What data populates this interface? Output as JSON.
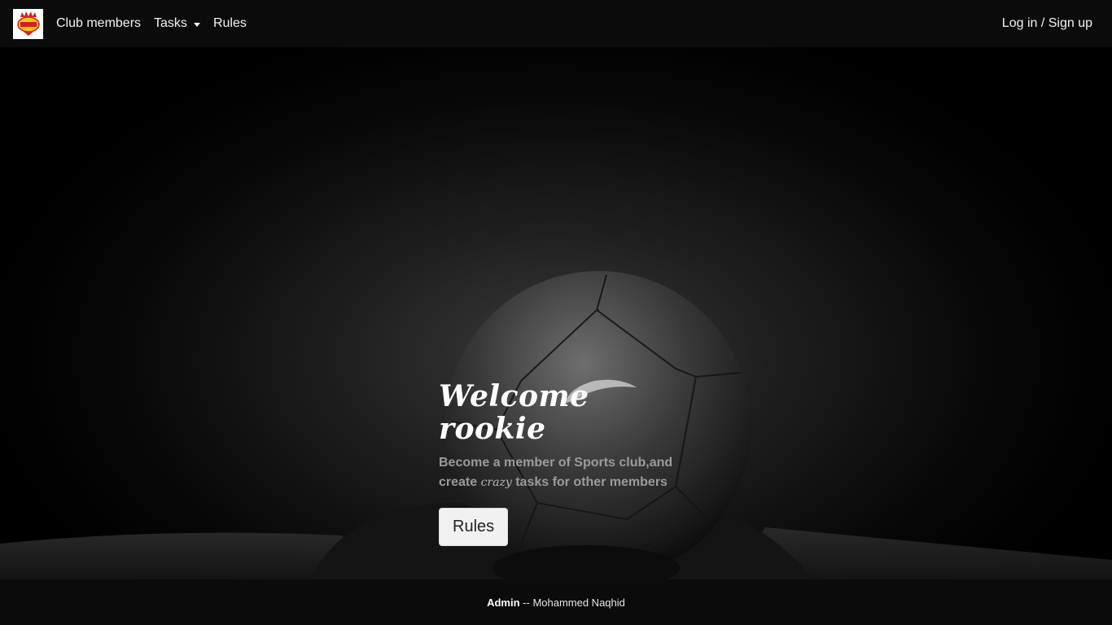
{
  "nav": {
    "logo_icon": "sports-club-logo",
    "items": [
      {
        "label": "Club members"
      },
      {
        "label": "Tasks"
      },
      {
        "label": "Rules"
      }
    ],
    "auth_label": "Log in / Sign up"
  },
  "hero": {
    "title": "Welcome rookie",
    "text_before": "Become a member of Sports club,and create ",
    "text_accent": "crazy",
    "text_after": " tasks for other members",
    "button_label": "Rules"
  },
  "footer": {
    "role": "Admin",
    "separator": " -- ",
    "name": "Mohammed Naqhid"
  },
  "colors": {
    "navbar_bg": "#0b0b0b",
    "footer_bg": "#0b0b0b",
    "logo_red": "#d02222",
    "logo_yellow": "#f5c518"
  }
}
